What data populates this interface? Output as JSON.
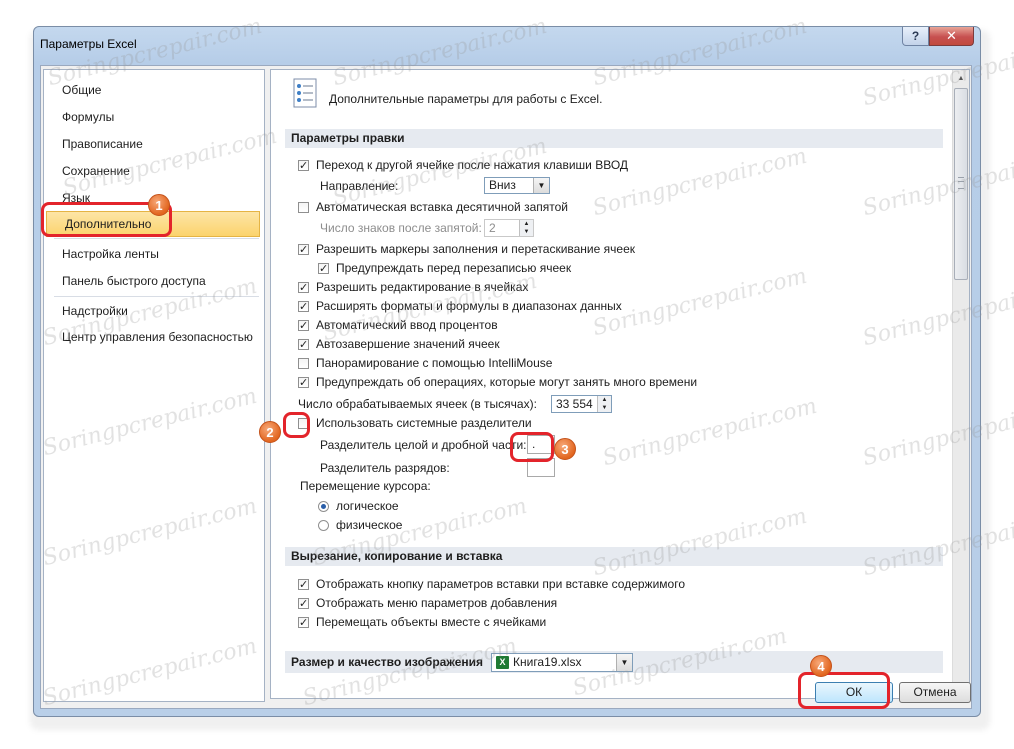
{
  "window": {
    "title": "Параметры Excel",
    "help": "?",
    "close": "✕"
  },
  "sidebar": {
    "items": [
      {
        "label": "Общие"
      },
      {
        "label": "Формулы"
      },
      {
        "label": "Правописание"
      },
      {
        "label": "Сохранение"
      },
      {
        "label": "Язык"
      },
      {
        "label": "Дополнительно"
      },
      {
        "label": "Настройка ленты"
      },
      {
        "label": "Панель быстрого доступа"
      },
      {
        "label": "Надстройки"
      },
      {
        "label": "Центр управления безопасностью"
      }
    ],
    "selected": "Дополнительно"
  },
  "content": {
    "header": "Дополнительные параметры для работы с Excel.",
    "sections": {
      "editing": "Параметры правки",
      "cut_copy": "Вырезание, копирование и вставка",
      "image_size": "Размер и качество изображения"
    },
    "editing": {
      "move_after_enter": "Переход к другой ячейке после нажатия клавиши ВВОД",
      "direction_label": "Направление:",
      "direction_value": "Вниз",
      "auto_decimal": "Автоматическая вставка десятичной запятой",
      "places_label": "Число знаков после запятой:",
      "places_value": "2",
      "fill_handle": "Разрешить маркеры заполнения и перетаскивание ячеек",
      "alert_overwrite": "Предупреждать перед перезаписью ячеек",
      "edit_in_cells": "Разрешить редактирование в ячейках",
      "extend_formats": "Расширять форматы и формулы в диапазонах данных",
      "auto_percent": "Автоматический ввод процентов",
      "autocomplete": "Автозавершение значений ячеек",
      "intellimouse": "Панорамирование с помощью IntelliMouse",
      "alert_long_ops": "Предупреждать об операциях, которые могут занять много времени",
      "cells_label": "Число обрабатываемых ячеек (в тысячах):",
      "cells_value": "33 554",
      "use_system_sep": "Использовать системные разделители",
      "decimal_sep_label": "Разделитель целой и дробной части:",
      "decimal_sep_value": ".",
      "thousands_sep_label": "Разделитель разрядов:",
      "thousands_sep_value": "",
      "cursor_label": "Перемещение курсора:",
      "cursor_logical": "логическое",
      "cursor_visual": "физическое"
    },
    "cut_copy": {
      "paste_options": "Отображать кнопку параметров вставки при вставке содержимого",
      "insert_options": "Отображать меню параметров добавления",
      "move_objects": "Перемещать объекты вместе с ячейками"
    },
    "image": {
      "file_value": "Книга19.xlsx",
      "file_icon_letter": "X"
    }
  },
  "footer": {
    "ok": "ОК",
    "cancel": "Отмена"
  },
  "annotations": [
    "1",
    "2",
    "3",
    "4"
  ],
  "watermark": "Soringpcrepair.com",
  "colors": {
    "highlight": "#e3242b",
    "badge": "#e2661f",
    "selected_nav": "#fbd36d"
  }
}
